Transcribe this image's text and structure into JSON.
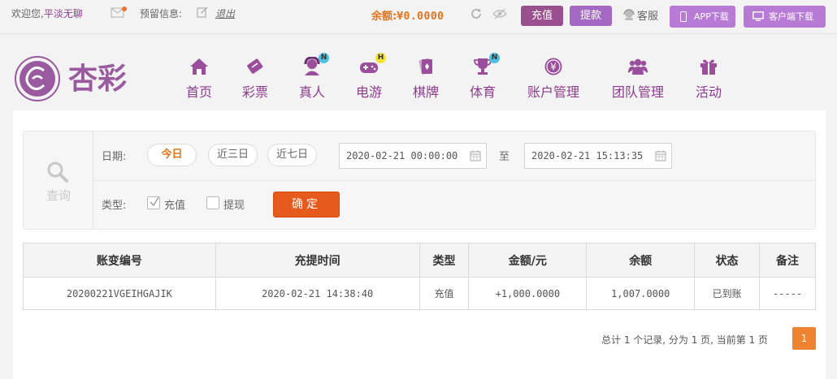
{
  "topbar": {
    "welcome": "欢迎您,",
    "username": "平淡无聊",
    "reserve_info": "预留信息:",
    "logout": "退出",
    "balance_label": "余额:",
    "balance_value": "¥0.0000",
    "recharge": "充值",
    "withdraw": "提款",
    "service": "客服",
    "app_download": "APP下载",
    "client_download": "客户端下载"
  },
  "logo": {
    "text": "杏彩"
  },
  "nav": [
    {
      "label": "首页",
      "icon": "home-icon"
    },
    {
      "label": "彩票",
      "icon": "lottery-ticket-icon"
    },
    {
      "label": "真人",
      "icon": "live-dealer-icon",
      "badge": "N"
    },
    {
      "label": "电游",
      "icon": "gamepad-icon",
      "badge": "H"
    },
    {
      "label": "棋牌",
      "icon": "cards-icon"
    },
    {
      "label": "体育",
      "icon": "trophy-icon",
      "badge": "N"
    },
    {
      "label": "账户管理",
      "icon": "yen-coin-icon"
    },
    {
      "label": "团队管理",
      "icon": "team-icon"
    },
    {
      "label": "活动",
      "icon": "gift-icon"
    }
  ],
  "filter": {
    "query_label": "查询",
    "date_label": "日期:",
    "ranges": [
      "今日",
      "近三日",
      "近七日"
    ],
    "active_range": "今日",
    "start": "2020-02-21 00:00:00",
    "to": "至",
    "end": "2020-02-21 15:13:35",
    "type_label": "类型:",
    "types": [
      {
        "label": "充值",
        "checked": true
      },
      {
        "label": "提现",
        "checked": false
      }
    ],
    "confirm": "确定"
  },
  "table": {
    "headers": [
      "账变编号",
      "充提时间",
      "类型",
      "金额/元",
      "余额",
      "状态",
      "备注"
    ],
    "rows": [
      [
        "20200221VGEIHGAJIK",
        "2020-02-21 14:38:40",
        "充值",
        "+1,000.0000",
        "1,007.0000",
        "已到账",
        "-----"
      ]
    ]
  },
  "pager": {
    "summary": "总计 1 个记录, 分为 1 页, 当前第 1 页",
    "current": "1"
  },
  "colors": {
    "brand": "#8c3c8e",
    "accent_orange": "#e5731a",
    "confirm_button": "#e65a1e",
    "status_ok": "#2e9c2e",
    "amount_positive": "#c0251c"
  }
}
